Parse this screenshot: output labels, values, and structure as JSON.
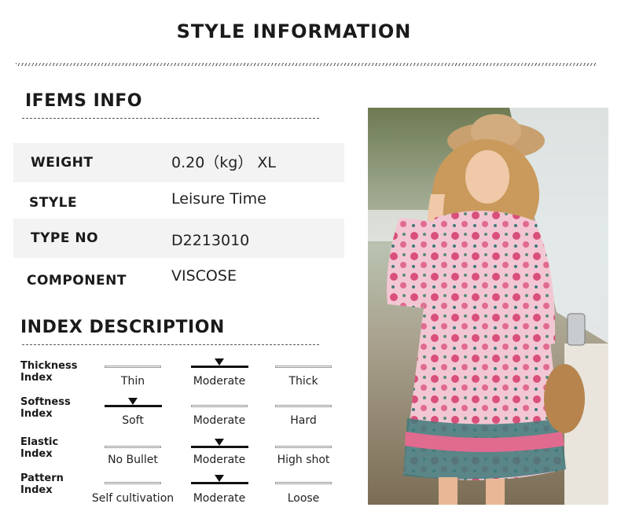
{
  "page_title": "STYLE INFORMATION",
  "items_title": "IFEMS INFO",
  "items": [
    {
      "label": "WEIGHT",
      "value": "0.20（kg） XL"
    },
    {
      "label": "STYLE",
      "value": "Leisure Time"
    },
    {
      "label": "TYPE NO",
      "value": "D2213010"
    },
    {
      "label": "COMPONENT",
      "value": "VISCOSE"
    }
  ],
  "index_title": "INDEX DESCRIPTION",
  "indices": [
    {
      "label_1": "Thickness",
      "label_2": "Index",
      "options": [
        "Thin",
        "Moderate",
        "Thick"
      ],
      "selected": 1
    },
    {
      "label_1": "Softness",
      "label_2": "Index",
      "options": [
        "Soft",
        "Moderate",
        "Hard"
      ],
      "selected": 0
    },
    {
      "label_1": "Elastic",
      "label_2": "Index",
      "options": [
        "No Bullet",
        "Moderate",
        "High shot"
      ],
      "selected": 1
    },
    {
      "label_1": "Pattern",
      "label_2": "Index",
      "options": [
        "Self cultivation",
        "Moderate",
        "Loose"
      ],
      "selected": 1
    }
  ],
  "photo": {
    "subject": "model-in-floral-dress",
    "colors": {
      "dress": "#e98aa6",
      "hem": "#3f7a7a",
      "sky": "#d9e6ea"
    }
  }
}
